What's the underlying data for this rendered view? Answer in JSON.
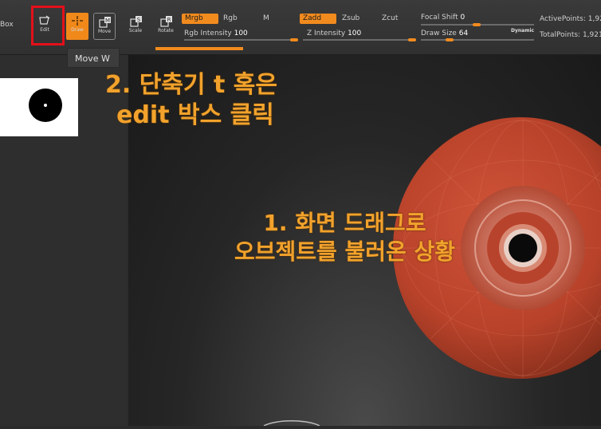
{
  "toolbar": {
    "lightbox_label": "Box",
    "tools": [
      {
        "label": "Edit",
        "icon": "edit-icon"
      },
      {
        "label": "Draw",
        "icon": "draw-icon"
      },
      {
        "label": "Move",
        "icon": "move-icon",
        "key": "M"
      },
      {
        "label": "Scale",
        "icon": "scale-icon",
        "key": "S"
      },
      {
        "label": "Rotate",
        "icon": "rotate-icon",
        "key": "R"
      }
    ],
    "mrgb": "Mrgb",
    "rgb": "Rgb",
    "m": "M",
    "zadd": "Zadd",
    "zsub": "Zsub",
    "zcut": "Zcut",
    "rgb_intensity_label": "Rgb Intensity",
    "rgb_intensity_value": "100",
    "z_intensity_label": "Z Intensity",
    "z_intensity_value": "100",
    "focal_shift_label": "Focal Shift",
    "focal_shift_value": "0",
    "draw_size_label": "Draw Size",
    "draw_size_value": "64",
    "dynamic_label": "Dynamic",
    "active_points": "ActivePoints: 1,92",
    "total_points": "TotalPoints: 1,921"
  },
  "tooltip": "Move  W",
  "annotations": {
    "step2_line1": "2. 단축기 t  혹은",
    "step2_line2": "edit 박스 클릭",
    "step1_line1": "1. 화면 드래그로",
    "step1_line2": "오브젝트를 불러온 상황"
  },
  "colors": {
    "accent": "#f28b1e",
    "highlight_box": "#e3101a",
    "annotation": "#f2a22c",
    "object": "#c0452a"
  }
}
